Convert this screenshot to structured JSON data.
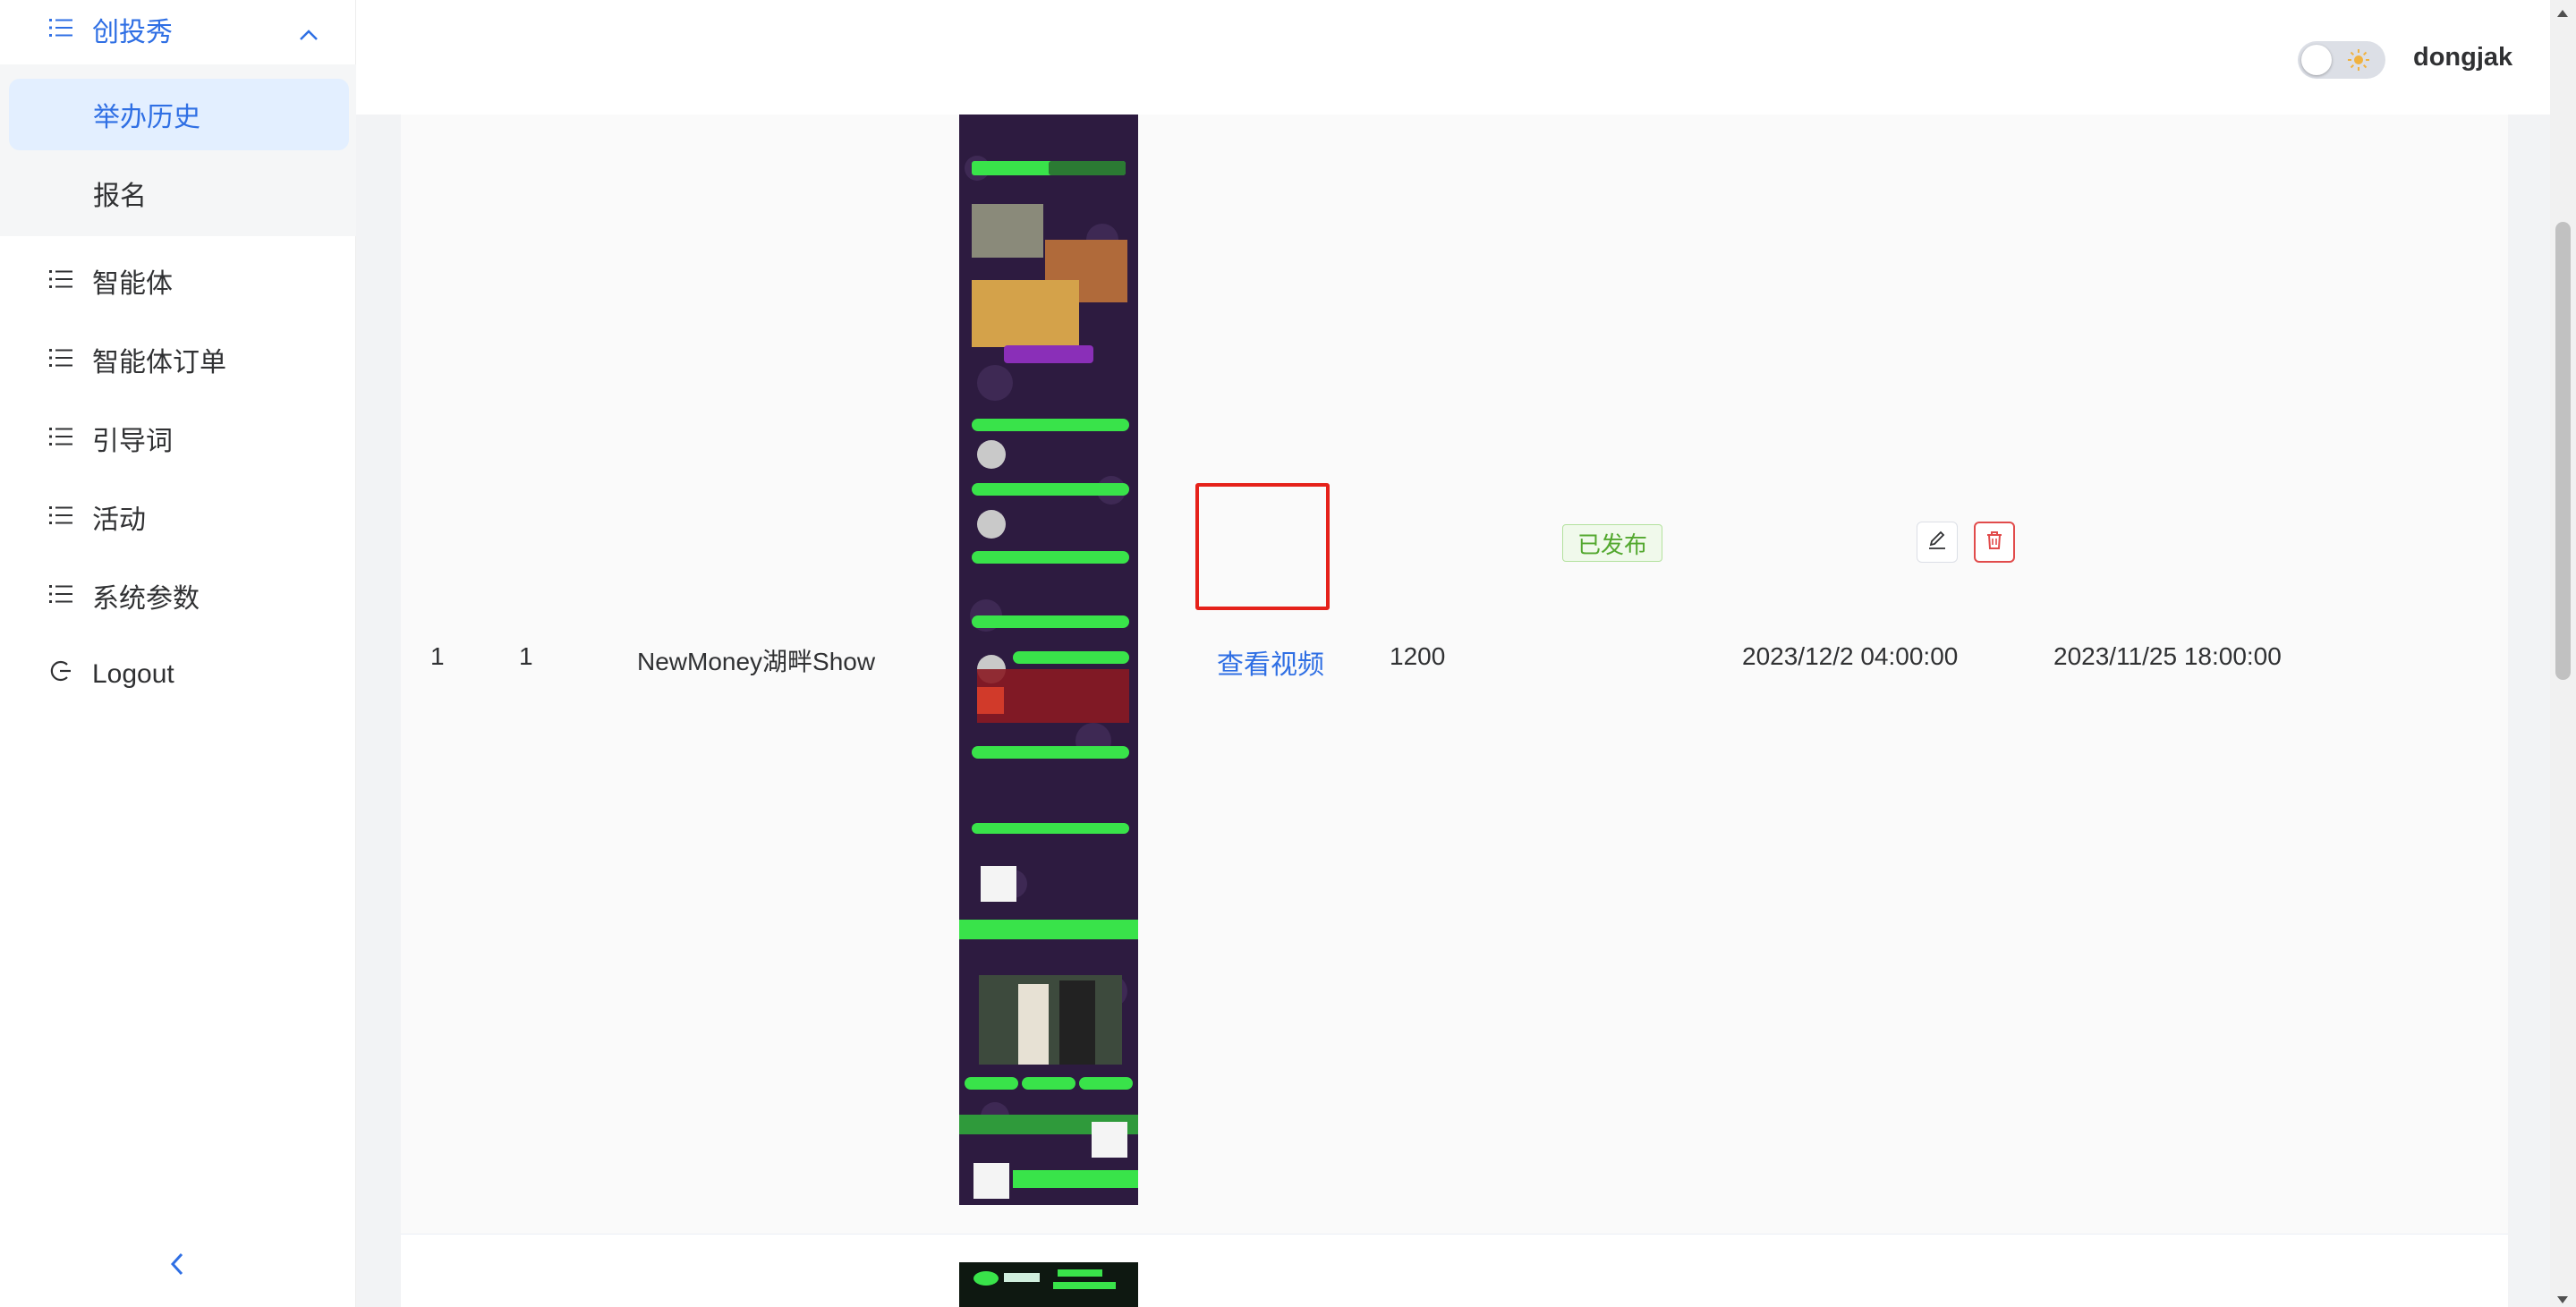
{
  "sidebar": {
    "group": {
      "label": "创投秀",
      "icon": "list-icon",
      "expanded": true
    },
    "subitems": [
      {
        "label": "举办历史",
        "active": true
      },
      {
        "label": "报名",
        "active": false
      }
    ],
    "items": [
      {
        "label": "智能体",
        "icon": "list-icon"
      },
      {
        "label": "智能体订单",
        "icon": "list-icon"
      },
      {
        "label": "引导词",
        "icon": "list-icon"
      },
      {
        "label": "活动",
        "icon": "list-icon"
      },
      {
        "label": "系统参数",
        "icon": "list-icon"
      },
      {
        "label": "Logout",
        "icon": "logout-icon"
      }
    ],
    "collapse_icon": "chevron-left-icon"
  },
  "header": {
    "theme_toggle": {
      "on": false,
      "icon": "sun-icon"
    },
    "username": "dongjak"
  },
  "table": {
    "rows": [
      {
        "index": "1",
        "id": "1",
        "name": "NewMoney湖畔Show",
        "video_link": "查看视频",
        "count": "1200",
        "status": "已发布",
        "start_time": "2023/12/2 04:00:00",
        "end_time": "2023/11/25 18:00:00",
        "actions": [
          "edit-icon",
          "delete-icon"
        ]
      }
    ]
  },
  "colors": {
    "accent": "#2f6fe4",
    "active_bg": "#e3efff",
    "success": "#53a82f",
    "danger": "#e14b4b",
    "highlight_box": "#e5211a"
  }
}
